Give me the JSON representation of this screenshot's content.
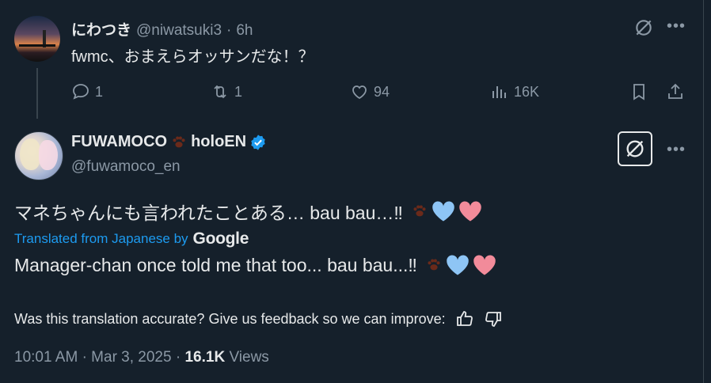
{
  "reply": {
    "display_name": "にわつき",
    "handle": "@niwatsuki3",
    "separator": "·",
    "time": "6h",
    "text": "fwmc、おまえらオッサンだな！？",
    "replies": "1",
    "reposts": "1",
    "likes": "94",
    "views": "16K"
  },
  "main": {
    "display_name": "FUWAMOCO",
    "display_name_suffix": "holoEN",
    "handle": "@fuwamoco_en",
    "original_text": "マネちゃんにも言われたことある… bau bau…‼",
    "translated_label": "Translated from Japanese by",
    "translator": "Google",
    "translated_text": "Manager-chan once told me that too... bau bau...‼",
    "feedback_prompt": "Was this translation accurate? Give us feedback so we can improve:",
    "time": "10:01 AM",
    "separator": "·",
    "date": "Mar 3, 2025",
    "separator2": "·",
    "views_count": "16.1K",
    "views_label": "Views"
  },
  "colors": {
    "background": "#15202b",
    "text": "#e7e9ea",
    "muted": "#8b98a5",
    "accent": "#1d9bf0",
    "heart_blue": "#8ec5f5",
    "heart_pink": "#f28b9a",
    "paw": "#6b2a1a"
  },
  "icons": [
    "grok-icon",
    "more-icon",
    "reply-icon",
    "repost-icon",
    "like-icon",
    "views-icon",
    "bookmark-icon",
    "share-icon",
    "verified-icon",
    "paw-icon",
    "blue-heart-icon",
    "pink-heart-icon",
    "thumbs-up-icon",
    "thumbs-down-icon"
  ]
}
